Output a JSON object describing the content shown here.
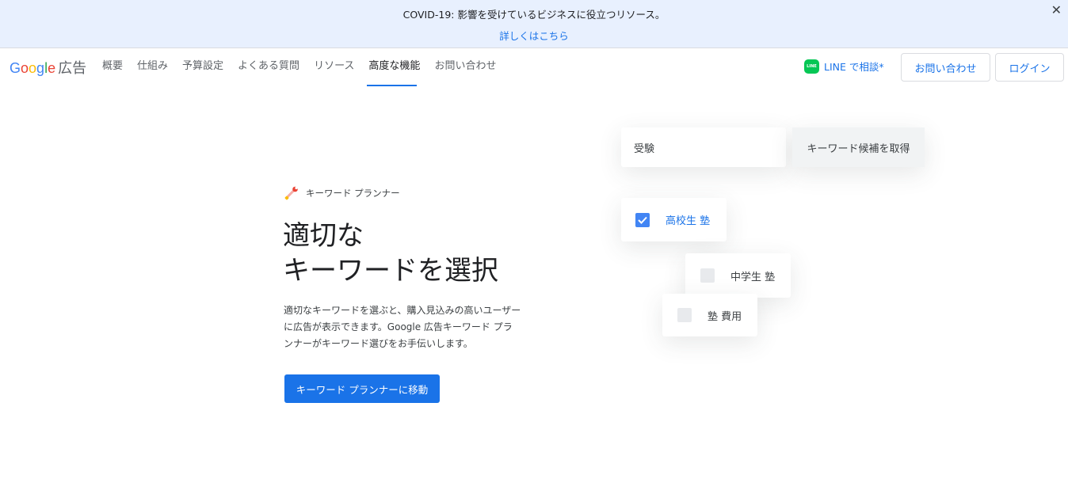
{
  "banner": {
    "text": "COVID-19: 影響を受けているビジネスに役立つリソース。",
    "link": "詳しくはこちら",
    "close": "✕"
  },
  "header": {
    "logo_google": [
      "G",
      "o",
      "o",
      "g",
      "l",
      "e"
    ],
    "logo_suffix": "広告",
    "nav": [
      "概要",
      "仕組み",
      "予算設定",
      "よくある質問",
      "リソース",
      "高度な機能",
      "お問い合わせ"
    ],
    "active_nav": "高度な機能",
    "line_label": "LINE で相談*",
    "line_icon_text": "LINE",
    "contact_button": "お問い合わせ",
    "login_button": "ログイン"
  },
  "hero": {
    "eyebrow": "キーワード プランナー",
    "headline_line1": "適切な",
    "headline_line2": "キーワードを選択",
    "description": "適切なキーワードを選ぶと、購入見込みの高いユーザーに広告が表示できます。Google 広告キーワード プランナーがキーワード選びをお手伝いします。",
    "cta": "キーワード プランナーに移動"
  },
  "illustration": {
    "input_value": "受験",
    "get_button": "キーワード候補を取得",
    "suggestions": [
      {
        "label": "高校生 塾",
        "checked": true
      },
      {
        "label": "中学生 塾",
        "checked": false
      },
      {
        "label": "塾 費用",
        "checked": false
      }
    ]
  },
  "colors": {
    "accent": "#1a73e8",
    "banner_bg": "#e8f0fe",
    "line_green": "#06c755",
    "checkbox_blue": "#4285f4"
  }
}
